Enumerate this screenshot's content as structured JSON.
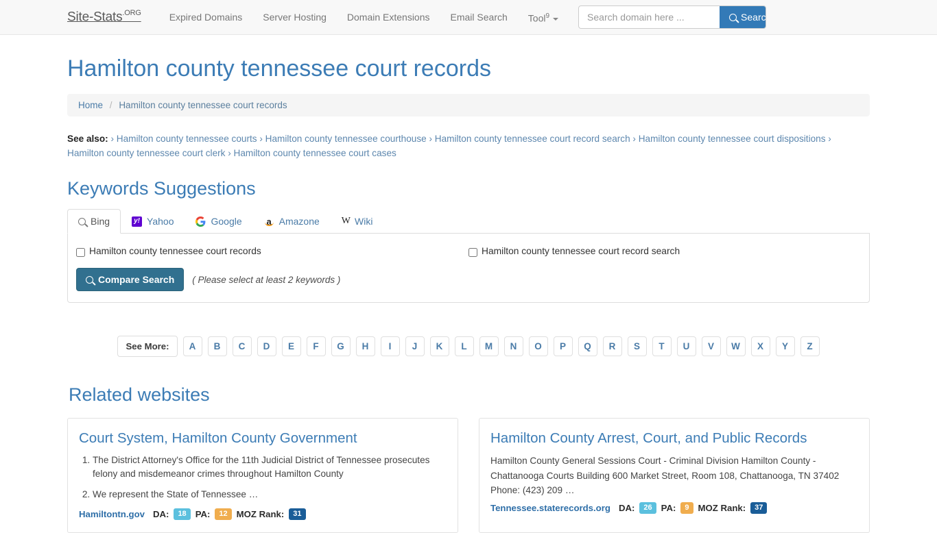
{
  "navbar": {
    "brand_main": "Site-Stats",
    "brand_suffix": ".ORG",
    "links": [
      {
        "label": "Expired Domains",
        "name": "nav-expired-domains"
      },
      {
        "label": "Server Hosting",
        "name": "nav-server-hosting"
      },
      {
        "label": "Domain Extensions",
        "name": "nav-domain-extensions"
      },
      {
        "label": "Email Search",
        "name": "nav-email-search"
      }
    ],
    "tool_label": "Tool",
    "tool_sup": "9",
    "search_placeholder": "Search domain here ...",
    "search_value": "",
    "search_button": "Search",
    "accent": "#337ab7"
  },
  "page": {
    "title": "Hamilton county tennessee court records"
  },
  "breadcrumb": {
    "home": "Home",
    "separator": "/",
    "current": "Hamilton county tennessee court records"
  },
  "see_also": {
    "label": "See also:",
    "chevron": "›",
    "items": [
      "Hamilton county tennessee courts",
      "Hamilton county tennessee courthouse",
      "Hamilton county tennessee court record search",
      "Hamilton county tennessee court dispositions",
      "Hamilton county tennessee court clerk",
      "Hamilton county tennessee court cases"
    ]
  },
  "keywords_section": {
    "title": "Keywords Suggestions",
    "tabs": [
      {
        "label": "Bing",
        "icon": "search-icon",
        "active": true
      },
      {
        "label": "Yahoo",
        "icon": "yahoo-icon",
        "active": false
      },
      {
        "label": "Google",
        "icon": "google-icon",
        "active": false
      },
      {
        "label": "Amazone",
        "icon": "amazon-icon",
        "active": false
      },
      {
        "label": "Wiki",
        "icon": "wikipedia-icon",
        "active": false
      }
    ],
    "keywords": [
      {
        "label": "Hamilton county tennessee court records",
        "checked": false
      },
      {
        "label": "Hamilton county tennessee court record search",
        "checked": false
      }
    ],
    "compare_button": "Compare Search",
    "compare_hint": "( Please select at least 2 keywords )"
  },
  "see_more": {
    "label": "See More:",
    "letters": [
      "A",
      "B",
      "C",
      "D",
      "E",
      "F",
      "G",
      "H",
      "I",
      "J",
      "K",
      "L",
      "M",
      "N",
      "O",
      "P",
      "Q",
      "R",
      "S",
      "T",
      "U",
      "V",
      "W",
      "X",
      "Y",
      "Z"
    ]
  },
  "related": {
    "title": "Related websites",
    "metric_labels": {
      "da": "DA:",
      "pa": "PA:",
      "moz": "MOZ Rank:"
    },
    "cards": [
      {
        "title": "Court System, Hamilton County Government",
        "list": [
          "The District Attorney's Office for the 11th Judicial District of Tennessee prosecutes felony and misdemeanor crimes throughout Hamilton County",
          "We represent the State of Tennessee …"
        ],
        "desc": "",
        "domain": "Hamiltontn.gov",
        "da": "18",
        "pa": "12",
        "moz": "31"
      },
      {
        "title": "Hamilton County Arrest, Court, and Public Records",
        "list": [],
        "desc": "Hamilton County General Sessions Court - Criminal Division Hamilton County - Chattanooga Courts Building 600 Market Street, Room 108, Chattanooga, TN 37402 Phone: (423) 209 …",
        "domain": "Tennessee.staterecords.org",
        "da": "26",
        "pa": "9",
        "moz": "37"
      }
    ]
  }
}
